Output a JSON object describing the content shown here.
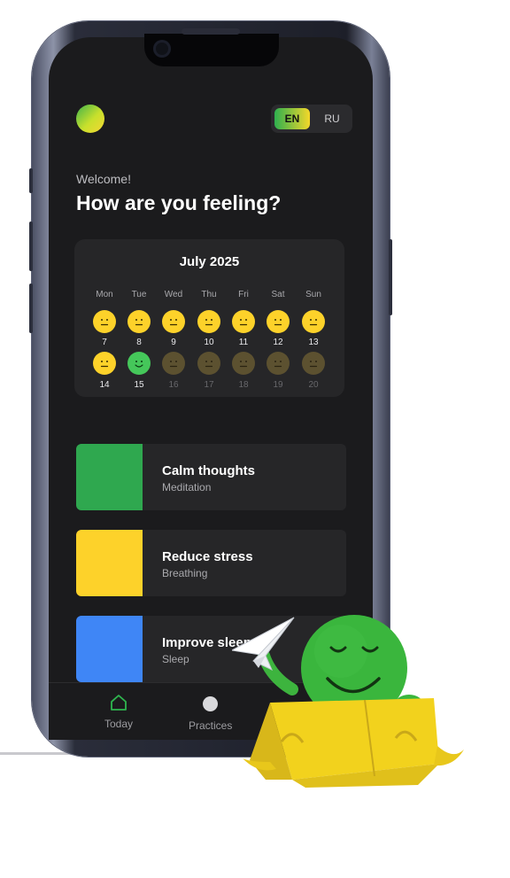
{
  "header": {
    "language_options": [
      {
        "code": "EN",
        "selected": true
      },
      {
        "code": "RU",
        "selected": false
      }
    ]
  },
  "greeting": {
    "welcome": "Welcome!",
    "question": "How are you feeling?"
  },
  "calendar": {
    "month_label": "July 2025",
    "weekdays": [
      "Mon",
      "Tue",
      "Wed",
      "Thu",
      "Fri",
      "Sat",
      "Sun"
    ],
    "rows": [
      [
        {
          "day": "7",
          "mood": "neutral"
        },
        {
          "day": "8",
          "mood": "neutral"
        },
        {
          "day": "9",
          "mood": "neutral"
        },
        {
          "day": "10",
          "mood": "neutral"
        },
        {
          "day": "11",
          "mood": "neutral"
        },
        {
          "day": "12",
          "mood": "neutral"
        },
        {
          "day": "13",
          "mood": "neutral"
        }
      ],
      [
        {
          "day": "14",
          "mood": "neutral"
        },
        {
          "day": "15",
          "mood": "happy"
        },
        {
          "day": "16",
          "mood": "future"
        },
        {
          "day": "17",
          "mood": "future"
        },
        {
          "day": "18",
          "mood": "future"
        },
        {
          "day": "19",
          "mood": "future"
        },
        {
          "day": "20",
          "mood": "future"
        }
      ]
    ]
  },
  "practices": [
    {
      "title": "Calm thoughts",
      "subtitle": "Meditation",
      "color": "#2fa84f"
    },
    {
      "title": "Reduce stress",
      "subtitle": "Breathing",
      "color": "#fdd22a"
    },
    {
      "title": "Improve sleep",
      "subtitle": "Sleep",
      "color": "#3f86f6"
    }
  ],
  "tabbar": {
    "tabs": [
      {
        "label": "Today",
        "icon": "home-icon",
        "active": true
      },
      {
        "label": "Practices",
        "icon": "circle-icon",
        "active": false
      }
    ]
  },
  "colors": {
    "background": "#1b1b1d",
    "card": "#262628",
    "mood_neutral": "#fdd22a",
    "mood_happy": "#45c75a",
    "mood_future": "#5c5130",
    "accent_green": "#2fa84f"
  },
  "overlay": {
    "icons": [
      "telegram-plane-icon",
      "mascot-in-box"
    ]
  }
}
